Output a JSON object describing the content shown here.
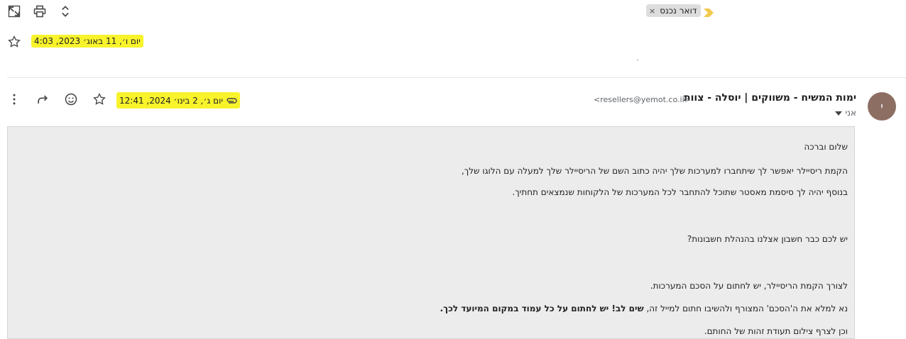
{
  "toolbar": {
    "icons": [
      "open-in-new-window-icon",
      "print-icon",
      "expand-collapse-icon"
    ]
  },
  "label": {
    "name": "דואר נכנס",
    "remove": "×"
  },
  "first_message": {
    "date": "יום ו׳, 11 באוג׳ 2023, 4:03"
  },
  "message": {
    "sender_name": "ימות המשיח - משווקים | יוסלה - צוות",
    "sender_email": "<resellers@yemot.co.il>",
    "to": "אני",
    "date": "יום ג׳, 2 בינו׳ 2024, 12:41",
    "body": {
      "p1": "שלום וברכה",
      "p2": "הקמת ריסיילר יאפשר לך שיתחברו למערכות שלך יהיה כתוב השם של הריסיילר שלך למעלה עם הלוגו שלך,",
      "p3": "בנוסף יהיה לך סיסמת מאסטר שתוכל להתחבר לכל המערכות של הלקוחות שנמצאים תחתיך.",
      "p4": "יש לכם כבר חשבון אצלנו בהנהלת חשבונות?",
      "p5": "לצורך הקמת הריסיילר, יש לחתום על הסכם המערכות.",
      "p6_normal": "נא למלא את ה'הסכם' המצורף ולהשיבו חתום למייל זה, ",
      "p6_bold": "שים לב! יש לחתום על כל עמוד במקום המיועד לכך.",
      "p7": "וכן לצרף צילום תעודת זהות של החותם."
    }
  },
  "colors": {
    "highlight": "#f8f32b",
    "avatar": "#8d6e63",
    "label_marker": "#f2c94c"
  }
}
